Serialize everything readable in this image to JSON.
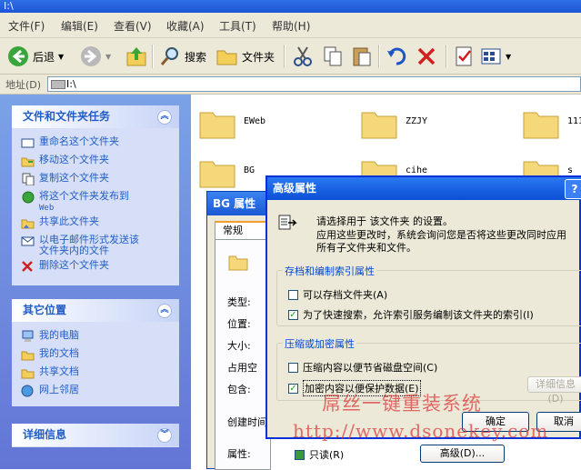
{
  "window": {
    "title": "I:\\"
  },
  "menu": [
    "文件(F)",
    "编辑(E)",
    "查看(V)",
    "收藏(A)",
    "工具(T)",
    "帮助(H)"
  ],
  "toolbar": {
    "back": "后退",
    "search": "搜索",
    "folders": "文件夹"
  },
  "address": {
    "label": "地址(D)",
    "value": "I:\\"
  },
  "tasks_panel": {
    "title": "文件和文件夹任务",
    "items": [
      "重命名这个文件夹",
      "移动这个文件夹",
      "复制这个文件夹",
      "将这个文件夹发布到",
      "Web",
      "共享此文件夹",
      "以电子邮件形式发送该",
      "文件夹内的文件",
      "删除这个文件夹"
    ]
  },
  "places_panel": {
    "title": "其它位置",
    "items": [
      "我的电脑",
      "我的文档",
      "共享文档",
      "网上邻居"
    ]
  },
  "details_panel": {
    "title": "详细信息"
  },
  "folders": [
    "EWeb",
    "ZZJY",
    "111",
    "BG",
    "cihe",
    "s"
  ],
  "props_dialog": {
    "title": "BG 属性",
    "tab": "常规",
    "fields": [
      "类型:",
      "位置:",
      "大小:",
      "占用空",
      "包含:",
      "创建时间",
      "属性:"
    ],
    "readonly_label": "只读(R)",
    "advanced_button": "高级(D)..."
  },
  "adv_dialog": {
    "title": "高级属性",
    "help": "?",
    "intro_line1": "请选择用于 该文件夹 的设置。",
    "intro_line2": "应用这些更改时，系统会询问您是否将这些更改同时应用",
    "intro_line3": "所有子文件夹和文件。",
    "group1": {
      "title": "存档和编制索引属性",
      "items": [
        {
          "label": "可以存档文件夹(A)",
          "checked": false
        },
        {
          "label": "为了快速搜索，允许索引服务编制该文件夹的索引(I)",
          "checked": true
        }
      ]
    },
    "group2": {
      "title": "压缩或加密属性",
      "items": [
        {
          "label": "压缩内容以便节省磁盘空间(C)",
          "checked": false
        },
        {
          "label": "加密内容以便保护数据(E)",
          "checked": true
        }
      ],
      "details_button": "详细信息(D)"
    },
    "ok": "确定",
    "cancel": "取消"
  },
  "watermark": {
    "line1": "屌丝一键重装系统",
    "line2": "http://www.dsonekey.com"
  }
}
